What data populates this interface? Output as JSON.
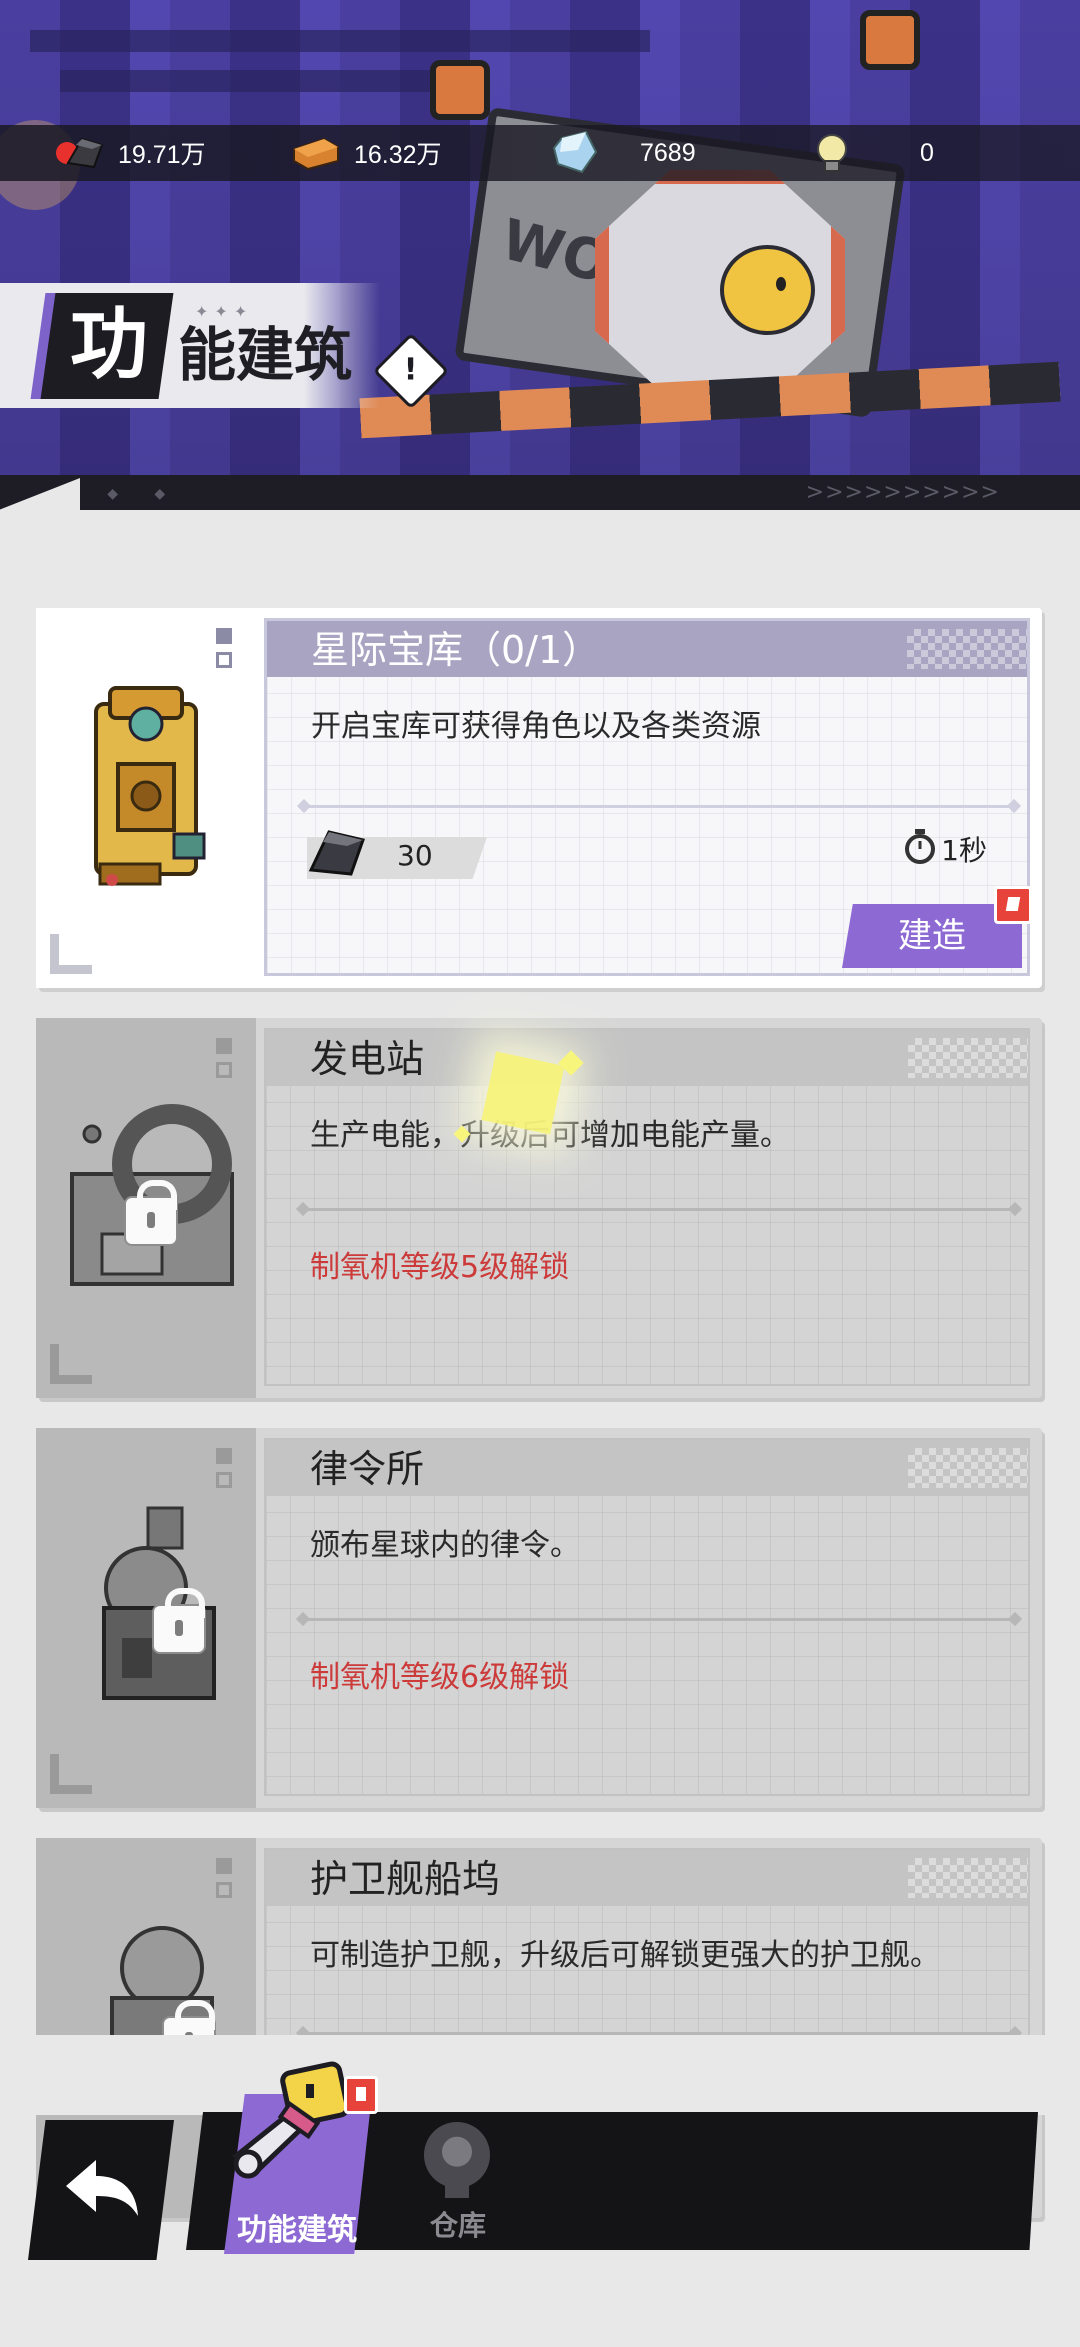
{
  "header": {
    "resources": [
      {
        "icon": "ore-icon",
        "value": "19.71万"
      },
      {
        "icon": "wood-icon",
        "value": "16.32万"
      },
      {
        "icon": "crystal-icon",
        "value": "7689"
      },
      {
        "icon": "bulb-icon",
        "value": "0"
      }
    ],
    "title_first_char": "功",
    "title_rest": "能建筑",
    "sign_text": "WORK",
    "footer_dots": "◇ ◆ ◆",
    "footer_arrows": ">>>>>>>>>>"
  },
  "buildings": [
    {
      "name": "星际宝库（0/1）",
      "description": "开启宝库可获得角色以及各类资源",
      "cost_icon": "ore-icon",
      "cost_value": "30",
      "time": "1秒",
      "build_label": "建造",
      "locked": false
    },
    {
      "name": "发电站",
      "description": "生产电能，升级后可增加电能产量。",
      "unlock_text": "制氧机等级5级解锁",
      "locked": true
    },
    {
      "name": "律令所",
      "description": "颁布星球内的律令。",
      "unlock_text": "制氧机等级6级解锁",
      "locked": true
    },
    {
      "name": "护卫舰船坞",
      "description": "可制造护卫舰，升级后可解锁更强大的护卫舰。",
      "locked": true
    }
  ],
  "nav": {
    "back_icon": "back-arrow-icon",
    "tabs": [
      {
        "label": "功能建筑",
        "icon": "wrench-robot-icon",
        "active": true
      },
      {
        "label": "仓库",
        "icon": "warehouse-icon",
        "active": false
      }
    ]
  },
  "colors": {
    "accent": "#8d69d4",
    "warning_text": "#cc3a3a",
    "header_bg": "#1c1b24",
    "alert": "#e8433a"
  }
}
